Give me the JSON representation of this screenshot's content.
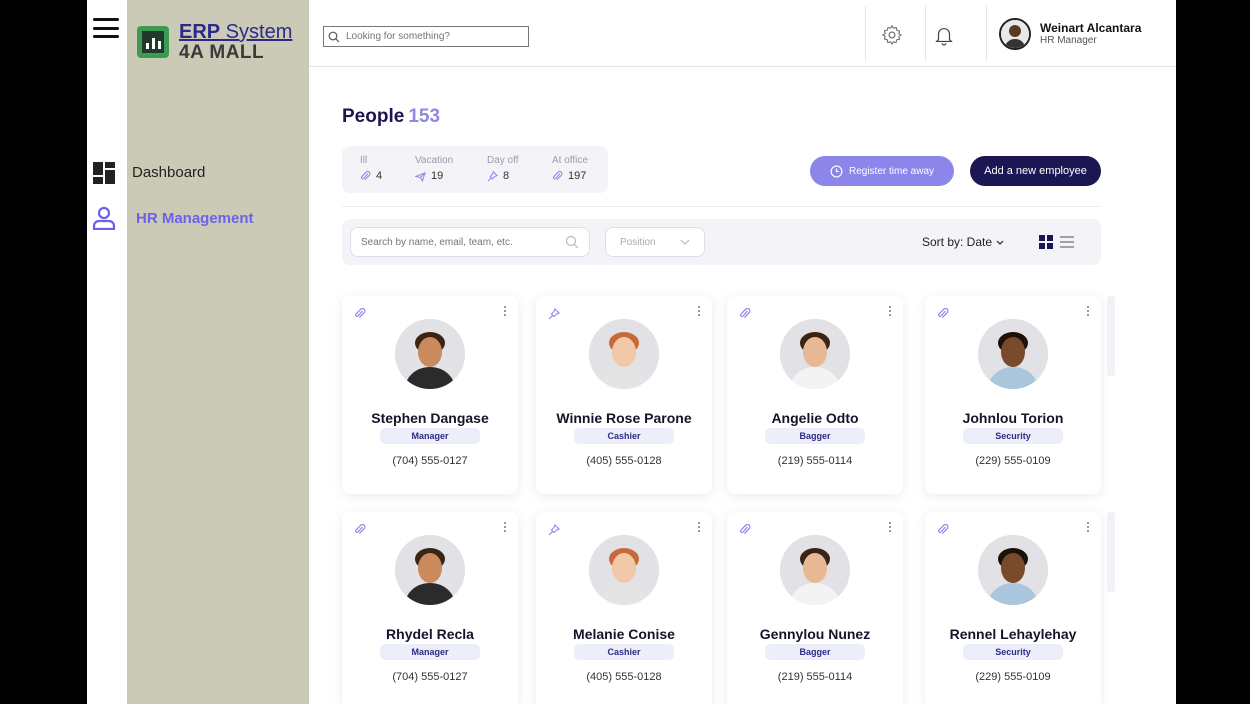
{
  "app": {
    "logo_line1_bold": "ERP",
    "logo_line1_rest": " System",
    "logo_line2": "4A MALL"
  },
  "sidebar": {
    "items": [
      {
        "label": "Dashboard",
        "icon": "dashboard-icon"
      },
      {
        "label": "HR Management",
        "icon": "user-icon",
        "active": true
      }
    ]
  },
  "topbar": {
    "search_placeholder": "Looking for something?",
    "user_name": "Weinart Alcantara",
    "user_role": "HR Manager"
  },
  "page": {
    "title": "People",
    "count": "153"
  },
  "stats": [
    {
      "label": "Ill",
      "value": "4",
      "icon": "paperclip-icon"
    },
    {
      "label": "Vacation",
      "value": "19",
      "icon": "plane-icon"
    },
    {
      "label": "Day off",
      "value": "8",
      "icon": "pin-icon"
    },
    {
      "label": "At office",
      "value": "197",
      "icon": "paperclip-icon"
    }
  ],
  "actions": {
    "register_away": "Register time away",
    "add_employee": "Add a new employee"
  },
  "filters": {
    "search_placeholder": "Search by name, email, team, etc.",
    "position_label": "Position",
    "sort_label": "Sort by: Date"
  },
  "employees": [
    {
      "name": "Stephen Dangase",
      "role": "Manager",
      "phone": "(704) 555-0127",
      "status_icon": "paperclip-icon"
    },
    {
      "name": "Winnie Rose Parone",
      "role": "Cashier",
      "phone": "(405) 555-0128",
      "status_icon": "pin-icon"
    },
    {
      "name": "Angelie Odto",
      "role": "Bagger",
      "phone": "(219) 555-0114",
      "status_icon": "paperclip-icon"
    },
    {
      "name": "Johnlou Torion",
      "role": "Security",
      "phone": "(229) 555-0109",
      "status_icon": "paperclip-icon"
    },
    {
      "name": "Rhydel Recla",
      "role": "Manager",
      "phone": "(704) 555-0127",
      "status_icon": "paperclip-icon"
    },
    {
      "name": "Melanie Conise",
      "role": "Cashier",
      "phone": "(405) 555-0128",
      "status_icon": "pin-icon"
    },
    {
      "name": "Gennylou Nunez",
      "role": "Bagger",
      "phone": "(219) 555-0114",
      "status_icon": "paperclip-icon"
    },
    {
      "name": "Rennel Lehaylehay",
      "role": "Security",
      "phone": "(229) 555-0109",
      "status_icon": "paperclip-icon"
    }
  ],
  "colors": {
    "accent": "#6b62e8",
    "primary_dark": "#1a1752",
    "button_light": "#8c86ea",
    "sidebar_bg": "#cbcab6"
  }
}
